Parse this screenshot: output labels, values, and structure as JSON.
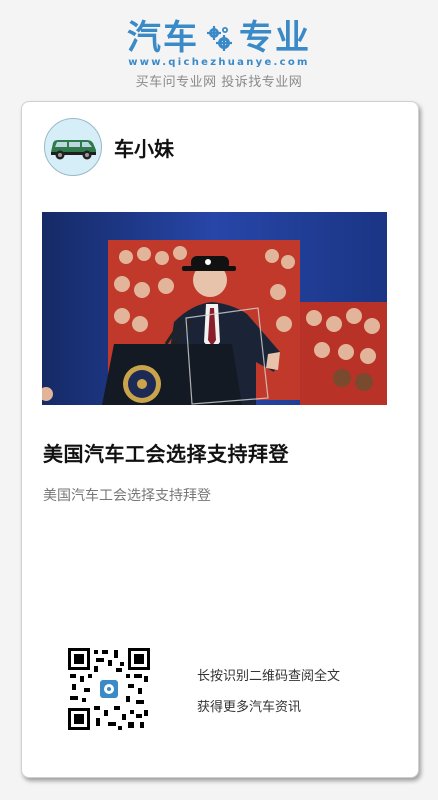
{
  "header": {
    "logo_left": "汽车",
    "logo_right": "专业",
    "logo_url": "www.qichezhuanye.com",
    "slogan": "买车问专业网 投诉找专业网",
    "brand_color": "#3a8ac8",
    "logo_icon": "gear-icon"
  },
  "card": {
    "author": {
      "name": "车小妹",
      "avatar_icon": "car-avatar-icon"
    },
    "cover_image": "photo-speaker-at-podium",
    "article": {
      "title": "美国汽车工会选择支持拜登",
      "summary": "美国汽车工会选择支持拜登"
    },
    "qr": {
      "icon": "qr-code-icon",
      "line1": "长按识别二维码查阅全文",
      "line2": "获得更多汽车资讯"
    }
  }
}
